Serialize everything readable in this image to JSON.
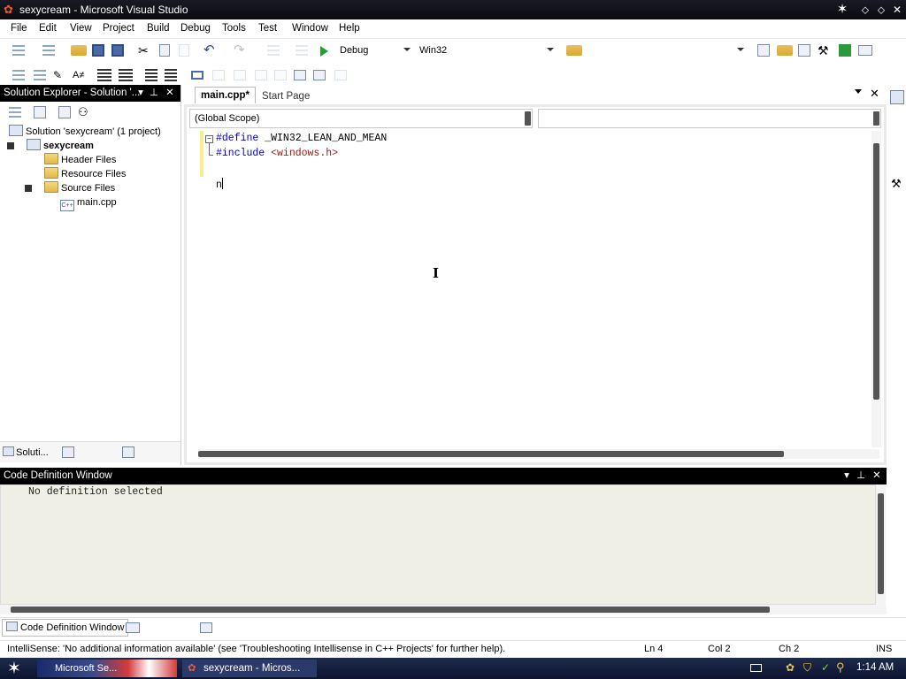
{
  "window": {
    "title": "sexycream - Microsoft Visual Studio",
    "buttons": [
      "✕",
      "⬦",
      "⬦",
      "✕"
    ]
  },
  "menu": [
    "File",
    "Edit",
    "View",
    "Project",
    "Build",
    "Debug",
    "Tools",
    "Test",
    "Window",
    "Help"
  ],
  "toolbar": {
    "config": "Debug",
    "platform": "Win32",
    "find_value": ""
  },
  "solution_explorer": {
    "title": "Solution Explorer - Solution '...",
    "solution": "Solution 'sexycream' (1 project)",
    "project": "sexycream",
    "folders": [
      "Header Files",
      "Resource Files",
      "Source Files"
    ],
    "file": "main.cpp",
    "bottom_tabs": [
      "Soluti..."
    ]
  },
  "editor": {
    "tabs": [
      "main.cpp*",
      "Start Page"
    ],
    "scope": "(Global Scope)",
    "member": "",
    "lines": [
      {
        "kw": "#define",
        "rest": " _WIN32_LEAN_AND_MEAN"
      },
      {
        "kw": "#include",
        "rest": " <windows.h>"
      },
      {
        "kw": "",
        "rest": ""
      },
      {
        "kw": "",
        "rest": "n"
      }
    ]
  },
  "code_definition": {
    "title": "Code Definition Window",
    "message": "No definition selected",
    "bottom_tabs": [
      "Code Definition Window"
    ]
  },
  "status": {
    "message": "IntelliSense: 'No additional information available'  (see 'Troubleshooting Intellisense in C++ Projects' for further help).",
    "ln": "Ln 4",
    "col": "Col 2",
    "ch": "Ch 2",
    "mode": "INS"
  },
  "taskbar": {
    "items": [
      "Microsoft Se...",
      "sexycream - Micros..."
    ],
    "clock": "1:14 AM"
  },
  "colors": {
    "accent": "#0a246a",
    "title_bg": "#111118",
    "panel_header": "#000000"
  },
  "icons": [
    "app-icon",
    "new-project-icon",
    "open-icon",
    "save-icon",
    "cut-icon",
    "copy-icon",
    "paste-icon",
    "undo-icon",
    "redo-icon",
    "start-debug-icon",
    "find-icon"
  ]
}
